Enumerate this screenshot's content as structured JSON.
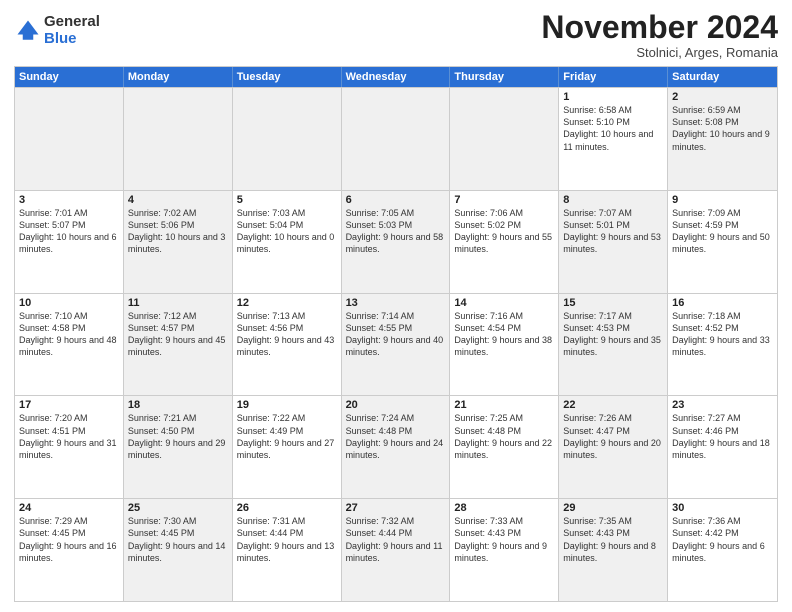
{
  "logo": {
    "general": "General",
    "blue": "Blue"
  },
  "header": {
    "month": "November 2024",
    "location": "Stolnici, Arges, Romania"
  },
  "weekdays": [
    "Sunday",
    "Monday",
    "Tuesday",
    "Wednesday",
    "Thursday",
    "Friday",
    "Saturday"
  ],
  "rows": [
    [
      {
        "day": "",
        "info": "",
        "shaded": true
      },
      {
        "day": "",
        "info": "",
        "shaded": true
      },
      {
        "day": "",
        "info": "",
        "shaded": true
      },
      {
        "day": "",
        "info": "",
        "shaded": true
      },
      {
        "day": "",
        "info": "",
        "shaded": true
      },
      {
        "day": "1",
        "info": "Sunrise: 6:58 AM\nSunset: 5:10 PM\nDaylight: 10 hours and 11 minutes.",
        "shaded": false
      },
      {
        "day": "2",
        "info": "Sunrise: 6:59 AM\nSunset: 5:08 PM\nDaylight: 10 hours and 9 minutes.",
        "shaded": true
      }
    ],
    [
      {
        "day": "3",
        "info": "Sunrise: 7:01 AM\nSunset: 5:07 PM\nDaylight: 10 hours and 6 minutes.",
        "shaded": false
      },
      {
        "day": "4",
        "info": "Sunrise: 7:02 AM\nSunset: 5:06 PM\nDaylight: 10 hours and 3 minutes.",
        "shaded": true
      },
      {
        "day": "5",
        "info": "Sunrise: 7:03 AM\nSunset: 5:04 PM\nDaylight: 10 hours and 0 minutes.",
        "shaded": false
      },
      {
        "day": "6",
        "info": "Sunrise: 7:05 AM\nSunset: 5:03 PM\nDaylight: 9 hours and 58 minutes.",
        "shaded": true
      },
      {
        "day": "7",
        "info": "Sunrise: 7:06 AM\nSunset: 5:02 PM\nDaylight: 9 hours and 55 minutes.",
        "shaded": false
      },
      {
        "day": "8",
        "info": "Sunrise: 7:07 AM\nSunset: 5:01 PM\nDaylight: 9 hours and 53 minutes.",
        "shaded": true
      },
      {
        "day": "9",
        "info": "Sunrise: 7:09 AM\nSunset: 4:59 PM\nDaylight: 9 hours and 50 minutes.",
        "shaded": false
      }
    ],
    [
      {
        "day": "10",
        "info": "Sunrise: 7:10 AM\nSunset: 4:58 PM\nDaylight: 9 hours and 48 minutes.",
        "shaded": false
      },
      {
        "day": "11",
        "info": "Sunrise: 7:12 AM\nSunset: 4:57 PM\nDaylight: 9 hours and 45 minutes.",
        "shaded": true
      },
      {
        "day": "12",
        "info": "Sunrise: 7:13 AM\nSunset: 4:56 PM\nDaylight: 9 hours and 43 minutes.",
        "shaded": false
      },
      {
        "day": "13",
        "info": "Sunrise: 7:14 AM\nSunset: 4:55 PM\nDaylight: 9 hours and 40 minutes.",
        "shaded": true
      },
      {
        "day": "14",
        "info": "Sunrise: 7:16 AM\nSunset: 4:54 PM\nDaylight: 9 hours and 38 minutes.",
        "shaded": false
      },
      {
        "day": "15",
        "info": "Sunrise: 7:17 AM\nSunset: 4:53 PM\nDaylight: 9 hours and 35 minutes.",
        "shaded": true
      },
      {
        "day": "16",
        "info": "Sunrise: 7:18 AM\nSunset: 4:52 PM\nDaylight: 9 hours and 33 minutes.",
        "shaded": false
      }
    ],
    [
      {
        "day": "17",
        "info": "Sunrise: 7:20 AM\nSunset: 4:51 PM\nDaylight: 9 hours and 31 minutes.",
        "shaded": false
      },
      {
        "day": "18",
        "info": "Sunrise: 7:21 AM\nSunset: 4:50 PM\nDaylight: 9 hours and 29 minutes.",
        "shaded": true
      },
      {
        "day": "19",
        "info": "Sunrise: 7:22 AM\nSunset: 4:49 PM\nDaylight: 9 hours and 27 minutes.",
        "shaded": false
      },
      {
        "day": "20",
        "info": "Sunrise: 7:24 AM\nSunset: 4:48 PM\nDaylight: 9 hours and 24 minutes.",
        "shaded": true
      },
      {
        "day": "21",
        "info": "Sunrise: 7:25 AM\nSunset: 4:48 PM\nDaylight: 9 hours and 22 minutes.",
        "shaded": false
      },
      {
        "day": "22",
        "info": "Sunrise: 7:26 AM\nSunset: 4:47 PM\nDaylight: 9 hours and 20 minutes.",
        "shaded": true
      },
      {
        "day": "23",
        "info": "Sunrise: 7:27 AM\nSunset: 4:46 PM\nDaylight: 9 hours and 18 minutes.",
        "shaded": false
      }
    ],
    [
      {
        "day": "24",
        "info": "Sunrise: 7:29 AM\nSunset: 4:45 PM\nDaylight: 9 hours and 16 minutes.",
        "shaded": false
      },
      {
        "day": "25",
        "info": "Sunrise: 7:30 AM\nSunset: 4:45 PM\nDaylight: 9 hours and 14 minutes.",
        "shaded": true
      },
      {
        "day": "26",
        "info": "Sunrise: 7:31 AM\nSunset: 4:44 PM\nDaylight: 9 hours and 13 minutes.",
        "shaded": false
      },
      {
        "day": "27",
        "info": "Sunrise: 7:32 AM\nSunset: 4:44 PM\nDaylight: 9 hours and 11 minutes.",
        "shaded": true
      },
      {
        "day": "28",
        "info": "Sunrise: 7:33 AM\nSunset: 4:43 PM\nDaylight: 9 hours and 9 minutes.",
        "shaded": false
      },
      {
        "day": "29",
        "info": "Sunrise: 7:35 AM\nSunset: 4:43 PM\nDaylight: 9 hours and 8 minutes.",
        "shaded": true
      },
      {
        "day": "30",
        "info": "Sunrise: 7:36 AM\nSunset: 4:42 PM\nDaylight: 9 hours and 6 minutes.",
        "shaded": false
      }
    ]
  ]
}
